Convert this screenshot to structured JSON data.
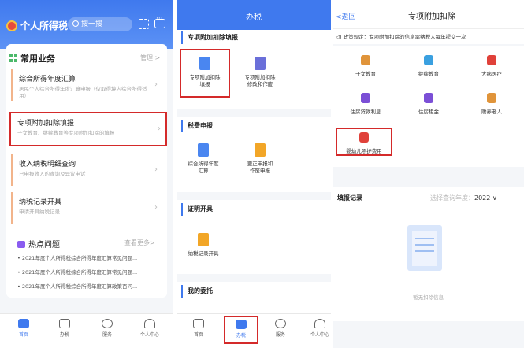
{
  "panel1": {
    "title": "个人所得税",
    "search_placeholder": "搜一搜",
    "section_title": "常用业务",
    "manage_label": "管理 >",
    "items": [
      {
        "title": "综合所得年度汇算",
        "subtitle": "居民个人综合所得年度汇算申报（仅取得境内综合所得适用）"
      },
      {
        "title": "专项附加扣除填报",
        "subtitle": "子女教育、继续教育等专项附加扣除的填报"
      },
      {
        "title": "收入纳税明细查询",
        "subtitle": "已申报收入的查询及异议申诉"
      },
      {
        "title": "纳税记录开具",
        "subtitle": "申请开具纳税记录"
      }
    ],
    "hot_title": "热点问题",
    "hot_more": "查看更多>",
    "hot_items": [
      "• 2021年度个人所得税综合所得年度汇算常见问题...",
      "• 2021年度个人所得税综合所得年度汇算常见问题...",
      "• 2021年度个人所得税综合所得年度汇算政策百问..."
    ],
    "tabs": [
      "首页",
      "办税",
      "服务",
      "个人中心"
    ]
  },
  "panel2": {
    "title": "办税",
    "sections": [
      {
        "title": "专项附加扣除填报",
        "tiles": [
          {
            "l1": "专项附加扣除",
            "l2": "填报"
          },
          {
            "l1": "专项附加扣除",
            "l2": "修改和作废"
          }
        ]
      },
      {
        "title": "税费申报",
        "tiles": [
          {
            "l1": "综合所得年度",
            "l2": "汇算"
          },
          {
            "l1": "更正申报和",
            "l2": "作废申报"
          }
        ]
      },
      {
        "title": "证明开具",
        "tiles": [
          {
            "l1": "纳税记录开具",
            "l2": ""
          }
        ]
      },
      {
        "title": "我的委托",
        "tiles": []
      }
    ],
    "tabs": [
      "首页",
      "办税",
      "服务",
      "个人中心"
    ]
  },
  "panel3": {
    "back": "<返回",
    "title": "专项附加扣除",
    "notice": "政策规定：专项附加扣除的信息需纳税人每年提交一次",
    "items": [
      "子女教育",
      "继续教育",
      "大病医疗",
      "住房贷款利息",
      "住房租金",
      "赡养老人",
      "婴幼儿照护费用"
    ],
    "record_title": "填报记录",
    "year_label": "选择查询年度：",
    "year_value": "2022",
    "empty_text": "暂无扣除信息"
  },
  "colors": {
    "brand": "#3f79ee",
    "highlight": "#d42a2a"
  }
}
